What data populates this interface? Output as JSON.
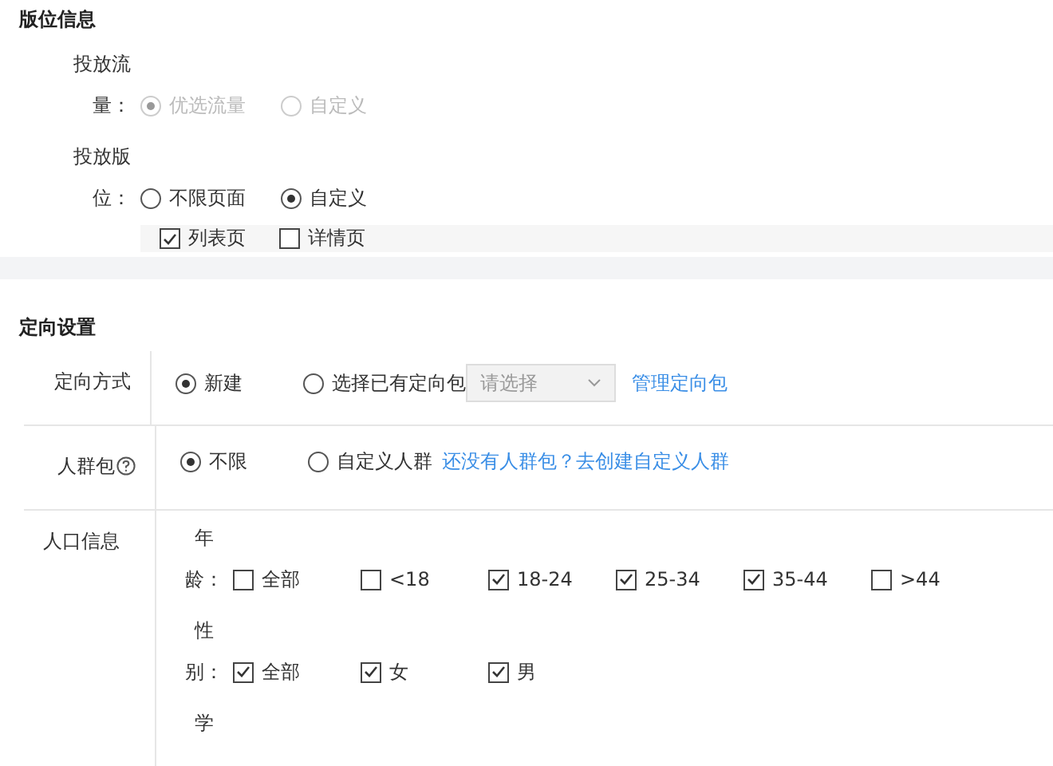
{
  "placement": {
    "title": "版位信息",
    "traffic": {
      "label": "投放流量：",
      "disabled": true,
      "options": [
        {
          "label": "优选流量",
          "selected": true
        },
        {
          "label": "自定义",
          "selected": false
        }
      ]
    },
    "position": {
      "label": "投放版位：",
      "options": [
        {
          "label": "不限页面",
          "selected": false
        },
        {
          "label": "自定义",
          "selected": true
        }
      ],
      "pages": [
        {
          "label": "列表页",
          "checked": true
        },
        {
          "label": "详情页",
          "checked": false
        }
      ]
    }
  },
  "targeting": {
    "title": "定向设置",
    "method": {
      "label": "定向方式",
      "options": [
        {
          "label": "新建",
          "selected": true
        },
        {
          "label": "选择已有定向包",
          "selected": false
        }
      ],
      "select": {
        "placeholder": "请选择",
        "disabled": true
      },
      "link": "管理定向包"
    },
    "audience": {
      "label": "人群包",
      "options": [
        {
          "label": "不限",
          "selected": true
        },
        {
          "label": "自定义人群",
          "selected": false
        }
      ],
      "link": "还没有人群包？去创建自定义人群"
    },
    "demographics": {
      "label": "人口信息",
      "groups": [
        {
          "label": "年龄：",
          "options": [
            {
              "label": "全部",
              "checked": false
            },
            {
              "label": "<18",
              "checked": false
            },
            {
              "label": "18-24",
              "checked": true
            },
            {
              "label": "25-34",
              "checked": true
            },
            {
              "label": "35-44",
              "checked": true
            },
            {
              "label": ">44",
              "checked": false
            }
          ]
        },
        {
          "label": "性别：",
          "options": [
            {
              "label": "全部",
              "checked": true
            },
            {
              "label": "女",
              "checked": true
            },
            {
              "label": "男",
              "checked": true
            }
          ]
        },
        {
          "label": "学"
        }
      ]
    }
  }
}
